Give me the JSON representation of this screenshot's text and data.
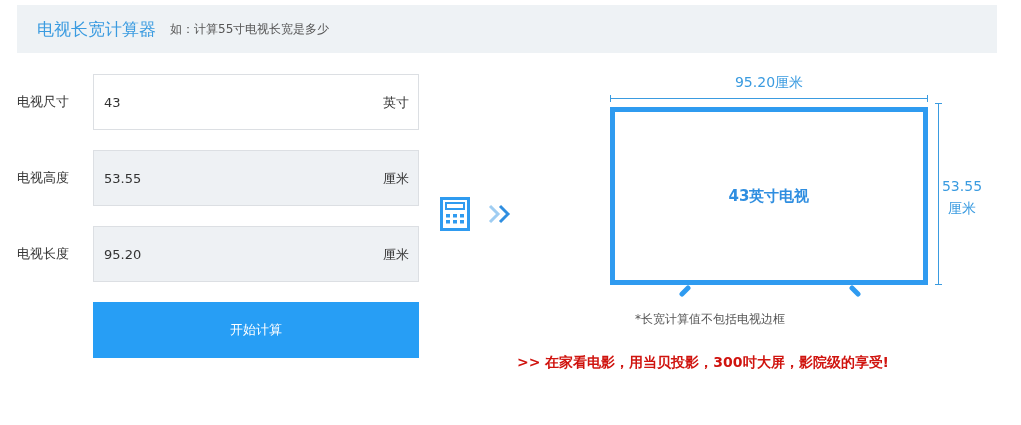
{
  "header": {
    "title": "电视长宽计算器",
    "hint": "如：计算55寸电视长宽是多少"
  },
  "fields": [
    {
      "label": "电视尺寸",
      "value": "43",
      "unit": "英寸",
      "readonly": false
    },
    {
      "label": "电视高度",
      "value": "53.55",
      "unit": "厘米",
      "readonly": true
    },
    {
      "label": "电视长度",
      "value": "95.20",
      "unit": "厘米",
      "readonly": true
    }
  ],
  "button": "开始计算",
  "diagram": {
    "width_label": "95.20厘米",
    "height_value": "53.55",
    "height_unit": "厘米",
    "screen_label": "43英寸电视",
    "note": "*长宽计算值不包括电视边框"
  },
  "promo": ">> 在家看电影，用当贝投影，300吋大屏，影院级的享受!"
}
